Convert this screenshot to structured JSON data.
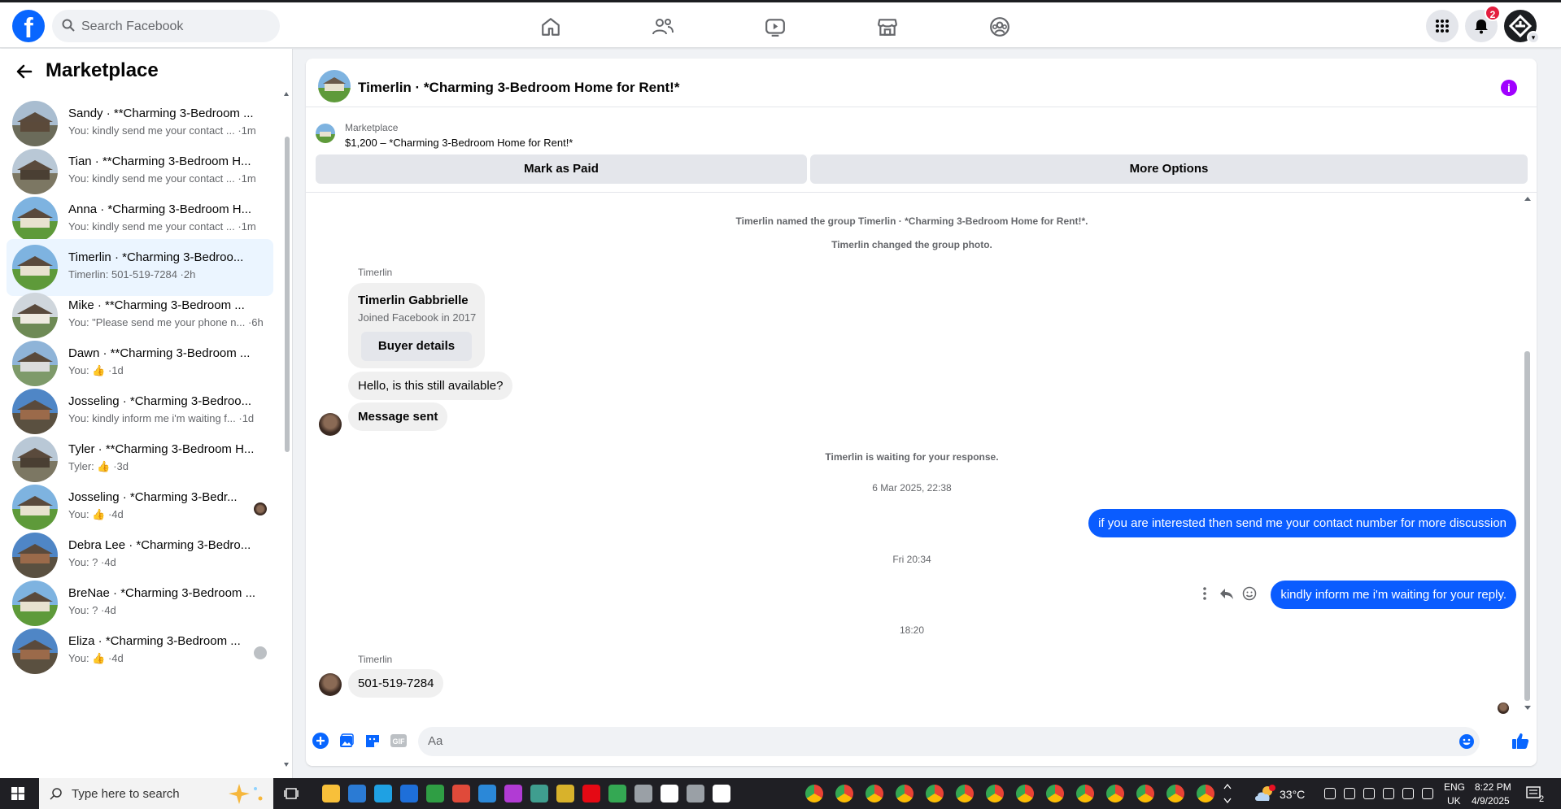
{
  "header": {
    "search_placeholder": "Search Facebook",
    "notification_count": "2"
  },
  "sidebar": {
    "title": "Marketplace",
    "conversations": [
      {
        "name": "Sandy · **Charming 3-Bedroom ...",
        "preview": "You: kindly send me your contact ... ·1m",
        "active": false
      },
      {
        "name": "Tian · **Charming 3-Bedroom H...",
        "preview": "You: kindly send me your contact ... ·1m",
        "active": false
      },
      {
        "name": "Anna · *Charming 3-Bedroom H...",
        "preview": "You: kindly send me your contact ... ·1m",
        "active": false
      },
      {
        "name": "Timerlin · *Charming 3-Bedroo...",
        "preview": "Timerlin: 501-519-7284 ·2h",
        "active": true
      },
      {
        "name": "Mike · **Charming 3-Bedroom ...",
        "preview": "You: \"Please send me your phone n... ·6h",
        "active": false
      },
      {
        "name": "Dawn · **Charming 3-Bedroom ...",
        "preview": "You: 👍 ·1d",
        "active": false
      },
      {
        "name": "Josseling · *Charming 3-Bedroo...",
        "preview": "You: kindly inform me i'm waiting f... ·1d",
        "active": false
      },
      {
        "name": "Tyler · **Charming 3-Bedroom H...",
        "preview": "Tyler: 👍 ·3d",
        "active": false
      },
      {
        "name": "Josseling · *Charming 3-Bedr...",
        "preview": "You: 👍 ·4d",
        "active": false
      },
      {
        "name": "Debra Lee · *Charming 3-Bedro...",
        "preview": "You: ? ·4d",
        "active": false
      },
      {
        "name": "BreNae · *Charming 3-Bedroom ...",
        "preview": "You: ? ·4d",
        "active": false
      },
      {
        "name": "Eliza · *Charming 3-Bedroom ...",
        "preview": "You: 👍 ·4d",
        "active": false
      }
    ]
  },
  "chat": {
    "title": "Timerlin · *Charming 3-Bedroom Home for Rent!*",
    "marketplace_label": "Marketplace",
    "listing": "$1,200 – *Charming 3-Bedroom Home for Rent!*",
    "mark_paid": "Mark as Paid",
    "more_options": "More Options",
    "system1": "Timerlin named the group Timerlin · *Charming 3-Bedroom Home for Rent!*.",
    "system2": "Timerlin changed the group photo.",
    "sender": "Timerlin",
    "card_name": "Timerlin Gabbrielle",
    "card_joined": "Joined Facebook in 2017",
    "card_button": "Buyer details",
    "msg1": "Hello, is this still available?",
    "msg2": "Message sent",
    "waiting": "Timerlin is waiting for your response.",
    "ts1": "6 Mar 2025, 22:38",
    "msg3": "if you are interested then send me your contact number for more  discussion",
    "ts2": "Fri 20:34",
    "msg4": "kindly inform me i'm waiting for your reply.",
    "ts3": "18:20",
    "sender2": "Timerlin",
    "msg5": "501-519-7284",
    "composer_placeholder": "Aa"
  },
  "taskbar": {
    "search_placeholder": "Type here to search",
    "weather": "33°C",
    "lang1": "ENG",
    "lang2": "UK",
    "time": "8:22 PM",
    "date": "4/9/2025",
    "notif_count": "2"
  },
  "colors": {
    "brand": "#0866ff",
    "bubble_me": "#0a5cff",
    "bubble_other": "#f0f0f0",
    "active_conv": "#ebf5ff",
    "info_icon": "#a000ff"
  }
}
